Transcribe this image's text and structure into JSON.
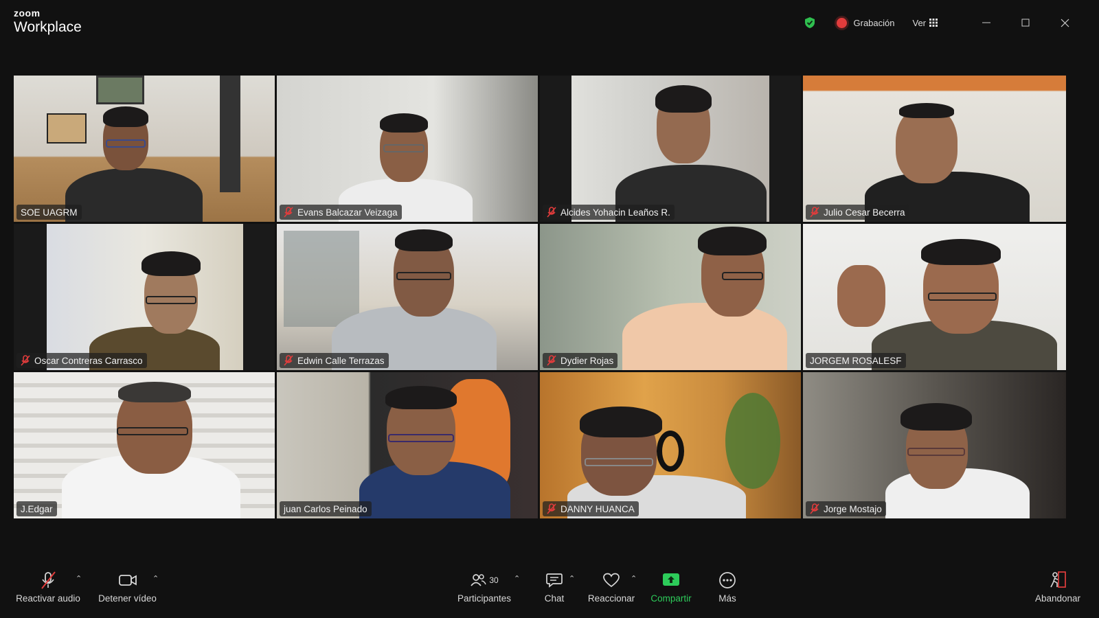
{
  "app": {
    "brand": "zoom",
    "product": "Workplace"
  },
  "header": {
    "recording_label": "Grabación",
    "view_label": "Ver"
  },
  "participants": [
    {
      "name": "SOE UAGRM",
      "muted": false,
      "active_speaker": true
    },
    {
      "name": "Evans Balcazar Veizaga",
      "muted": true
    },
    {
      "name": "Alcides Yohacin Leaños R.",
      "muted": true
    },
    {
      "name": "Julio Cesar Becerra",
      "muted": true
    },
    {
      "name": "Oscar Contreras Carrasco",
      "muted": true
    },
    {
      "name": "Edwin Calle Terrazas",
      "muted": true
    },
    {
      "name": "Dydier Rojas",
      "muted": true
    },
    {
      "name": "JORGEM ROSALESF",
      "muted": false
    },
    {
      "name": "J.Edgar",
      "muted": false
    },
    {
      "name": "juan Carlos Peinado",
      "muted": false
    },
    {
      "name": "DANNY HUANCA",
      "muted": true
    },
    {
      "name": "Jorge Mostajo",
      "muted": true
    }
  ],
  "toolbar": {
    "audio_label": "Reactivar audio",
    "video_label": "Detener vídeo",
    "participants_label": "Participantes",
    "participants_count": "30",
    "chat_label": "Chat",
    "react_label": "Reaccionar",
    "share_label": "Compartir",
    "more_label": "Más",
    "leave_label": "Abandonar"
  },
  "colors": {
    "background": "#111111",
    "active_speaker": "#3fc64f",
    "share": "#2dcc5a",
    "muted": "#e23c3c"
  }
}
